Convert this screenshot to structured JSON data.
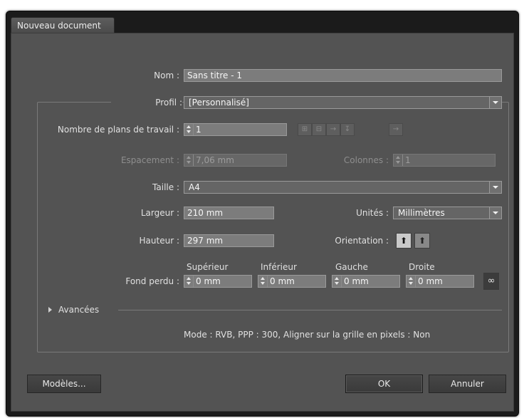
{
  "window": {
    "title": "Nouveau document"
  },
  "name": {
    "label": "Nom :",
    "value": "Sans titre - 1"
  },
  "profile": {
    "label": "Profil :",
    "value": "[Personnalisé]"
  },
  "artboards": {
    "label": "Nombre de plans de travail :",
    "value": "1",
    "layout_icons": [
      "grid-by-row-icon",
      "grid-by-column-icon",
      "arrange-by-row-icon",
      "arrange-by-column-icon",
      "right-to-left-icon"
    ]
  },
  "spacing": {
    "label": "Espacement :",
    "value": "7,06 mm"
  },
  "columns": {
    "label": "Colonnes :",
    "value": "1"
  },
  "size": {
    "label": "Taille :",
    "value": "A4"
  },
  "width": {
    "label": "Largeur :",
    "value": "210 mm"
  },
  "units": {
    "label": "Unités :",
    "value": "Millimètres"
  },
  "height": {
    "label": "Hauteur :",
    "value": "297 mm"
  },
  "orientation": {
    "label": "Orientation :",
    "selected": "portrait"
  },
  "bleed": {
    "label": "Fond perdu :",
    "top": {
      "label": "Supérieur",
      "value": "0 mm"
    },
    "bottom": {
      "label": "Inférieur",
      "value": "0 mm"
    },
    "left": {
      "label": "Gauche",
      "value": "0 mm"
    },
    "right": {
      "label": "Droite",
      "value": "0 mm"
    }
  },
  "advanced": {
    "label": "Avancées"
  },
  "info": {
    "text": "Mode : RVB, PPP : 300, Aligner sur la grille en pixels : Non"
  },
  "buttons": {
    "templates": "Modèles...",
    "ok": "OK",
    "cancel": "Annuler"
  },
  "colors": {
    "dialog_bg": "#535353",
    "field_bg": "#7c7c7c",
    "button_bg": "#3f3f3f"
  }
}
